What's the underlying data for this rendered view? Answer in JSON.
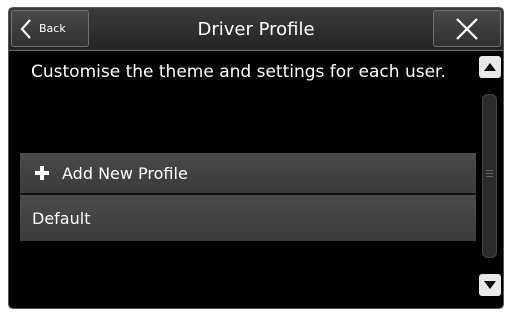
{
  "header": {
    "back_label": "Back",
    "title": "Driver Profile"
  },
  "main": {
    "description": "Customise the theme and settings for each user.",
    "items": [
      {
        "label": "Add New Profile",
        "icon": "plus-icon"
      },
      {
        "label": "Default"
      }
    ]
  },
  "icons": {
    "back": "chevron-left-icon",
    "close": "close-icon",
    "scroll_up": "triangle-up-icon",
    "scroll_down": "triangle-down-icon"
  },
  "colors": {
    "background": "#000000",
    "bar": "#3a3a3a",
    "text": "#ffffff"
  }
}
